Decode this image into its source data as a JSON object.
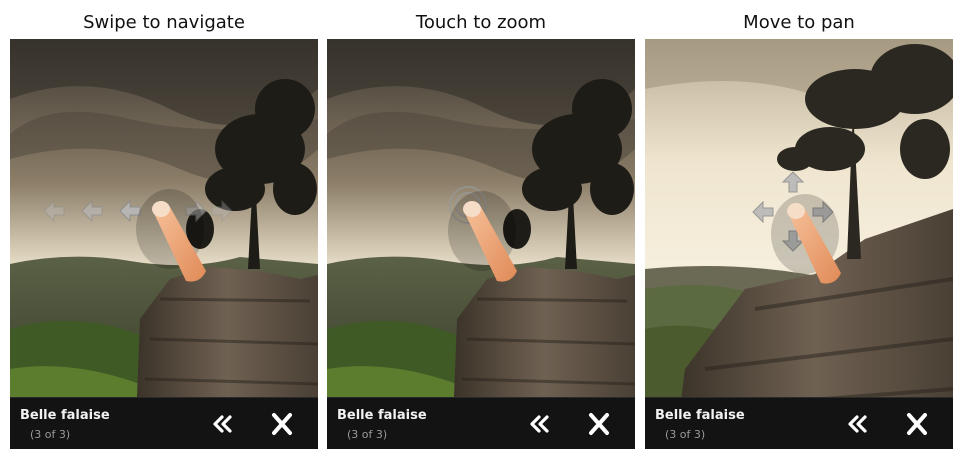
{
  "panels": [
    {
      "title": "Swipe to navigate",
      "gesture": "swipe",
      "caption": {
        "title": "Belle falaise",
        "count": "(3 of 3)"
      },
      "icons": {
        "back": "double-chevron-left-icon",
        "close": "close-x-icon",
        "hand": "pointing-finger-icon"
      }
    },
    {
      "title": "Touch to zoom",
      "gesture": "tap",
      "caption": {
        "title": "Belle falaise",
        "count": "(3 of 3)"
      },
      "icons": {
        "back": "double-chevron-left-icon",
        "close": "close-x-icon",
        "hand": "pointing-finger-icon"
      }
    },
    {
      "title": "Move to pan",
      "gesture": "pan",
      "caption": {
        "title": "Belle falaise",
        "count": "(3 of 3)"
      },
      "icons": {
        "back": "double-chevron-left-icon",
        "close": "close-x-icon",
        "hand": "pointing-finger-icon"
      }
    }
  ],
  "colors": {
    "caption_bg": "#131313",
    "caption_text": "#f2f2f2",
    "count_text": "#9a9a9a",
    "arrow": "#b8b8b8",
    "finger": "#f0a879"
  }
}
